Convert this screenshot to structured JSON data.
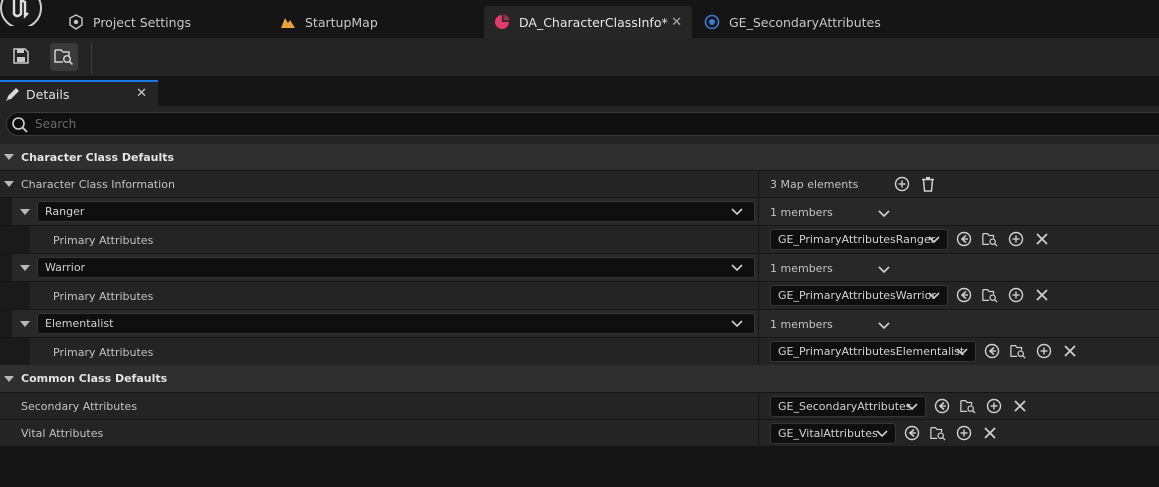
{
  "tabs": [
    {
      "label": "Project Settings",
      "icon": "gear-icon"
    },
    {
      "label": "StartupMap",
      "icon": "map-icon"
    },
    {
      "label": "DA_CharacterClassInfo*",
      "icon": "data-asset-icon",
      "active": true
    },
    {
      "label": "GE_SecondaryAttributes",
      "icon": "blueprint-icon"
    }
  ],
  "panel": {
    "title": "Details"
  },
  "search": {
    "placeholder": "Search"
  },
  "categories": {
    "character_class_defaults": "Character Class Defaults",
    "common_class_defaults": "Common Class Defaults"
  },
  "class_info": {
    "label": "Character Class Information",
    "map_count": "3 Map elements",
    "entries": [
      {
        "key": "Ranger",
        "members": "1 members",
        "child_label": "Primary Attributes",
        "child_value": "GE_PrimaryAttributesRanger"
      },
      {
        "key": "Warrior",
        "members": "1 members",
        "child_label": "Primary Attributes",
        "child_value": "GE_PrimaryAttributesWarrior"
      },
      {
        "key": "Elementalist",
        "members": "1 members",
        "child_label": "Primary Attributes",
        "child_value": "GE_PrimaryAttributesElementalist"
      }
    ]
  },
  "common": [
    {
      "label": "Secondary Attributes",
      "value": "GE_SecondaryAttributes"
    },
    {
      "label": "Vital Attributes",
      "value": "GE_VitalAttributes"
    }
  ],
  "colors": {
    "accent": "#1a78e6",
    "map_icon": "#e8a33a",
    "data_asset_icon": "#e23a6b",
    "blueprint_icon": "#3a7bd5"
  }
}
